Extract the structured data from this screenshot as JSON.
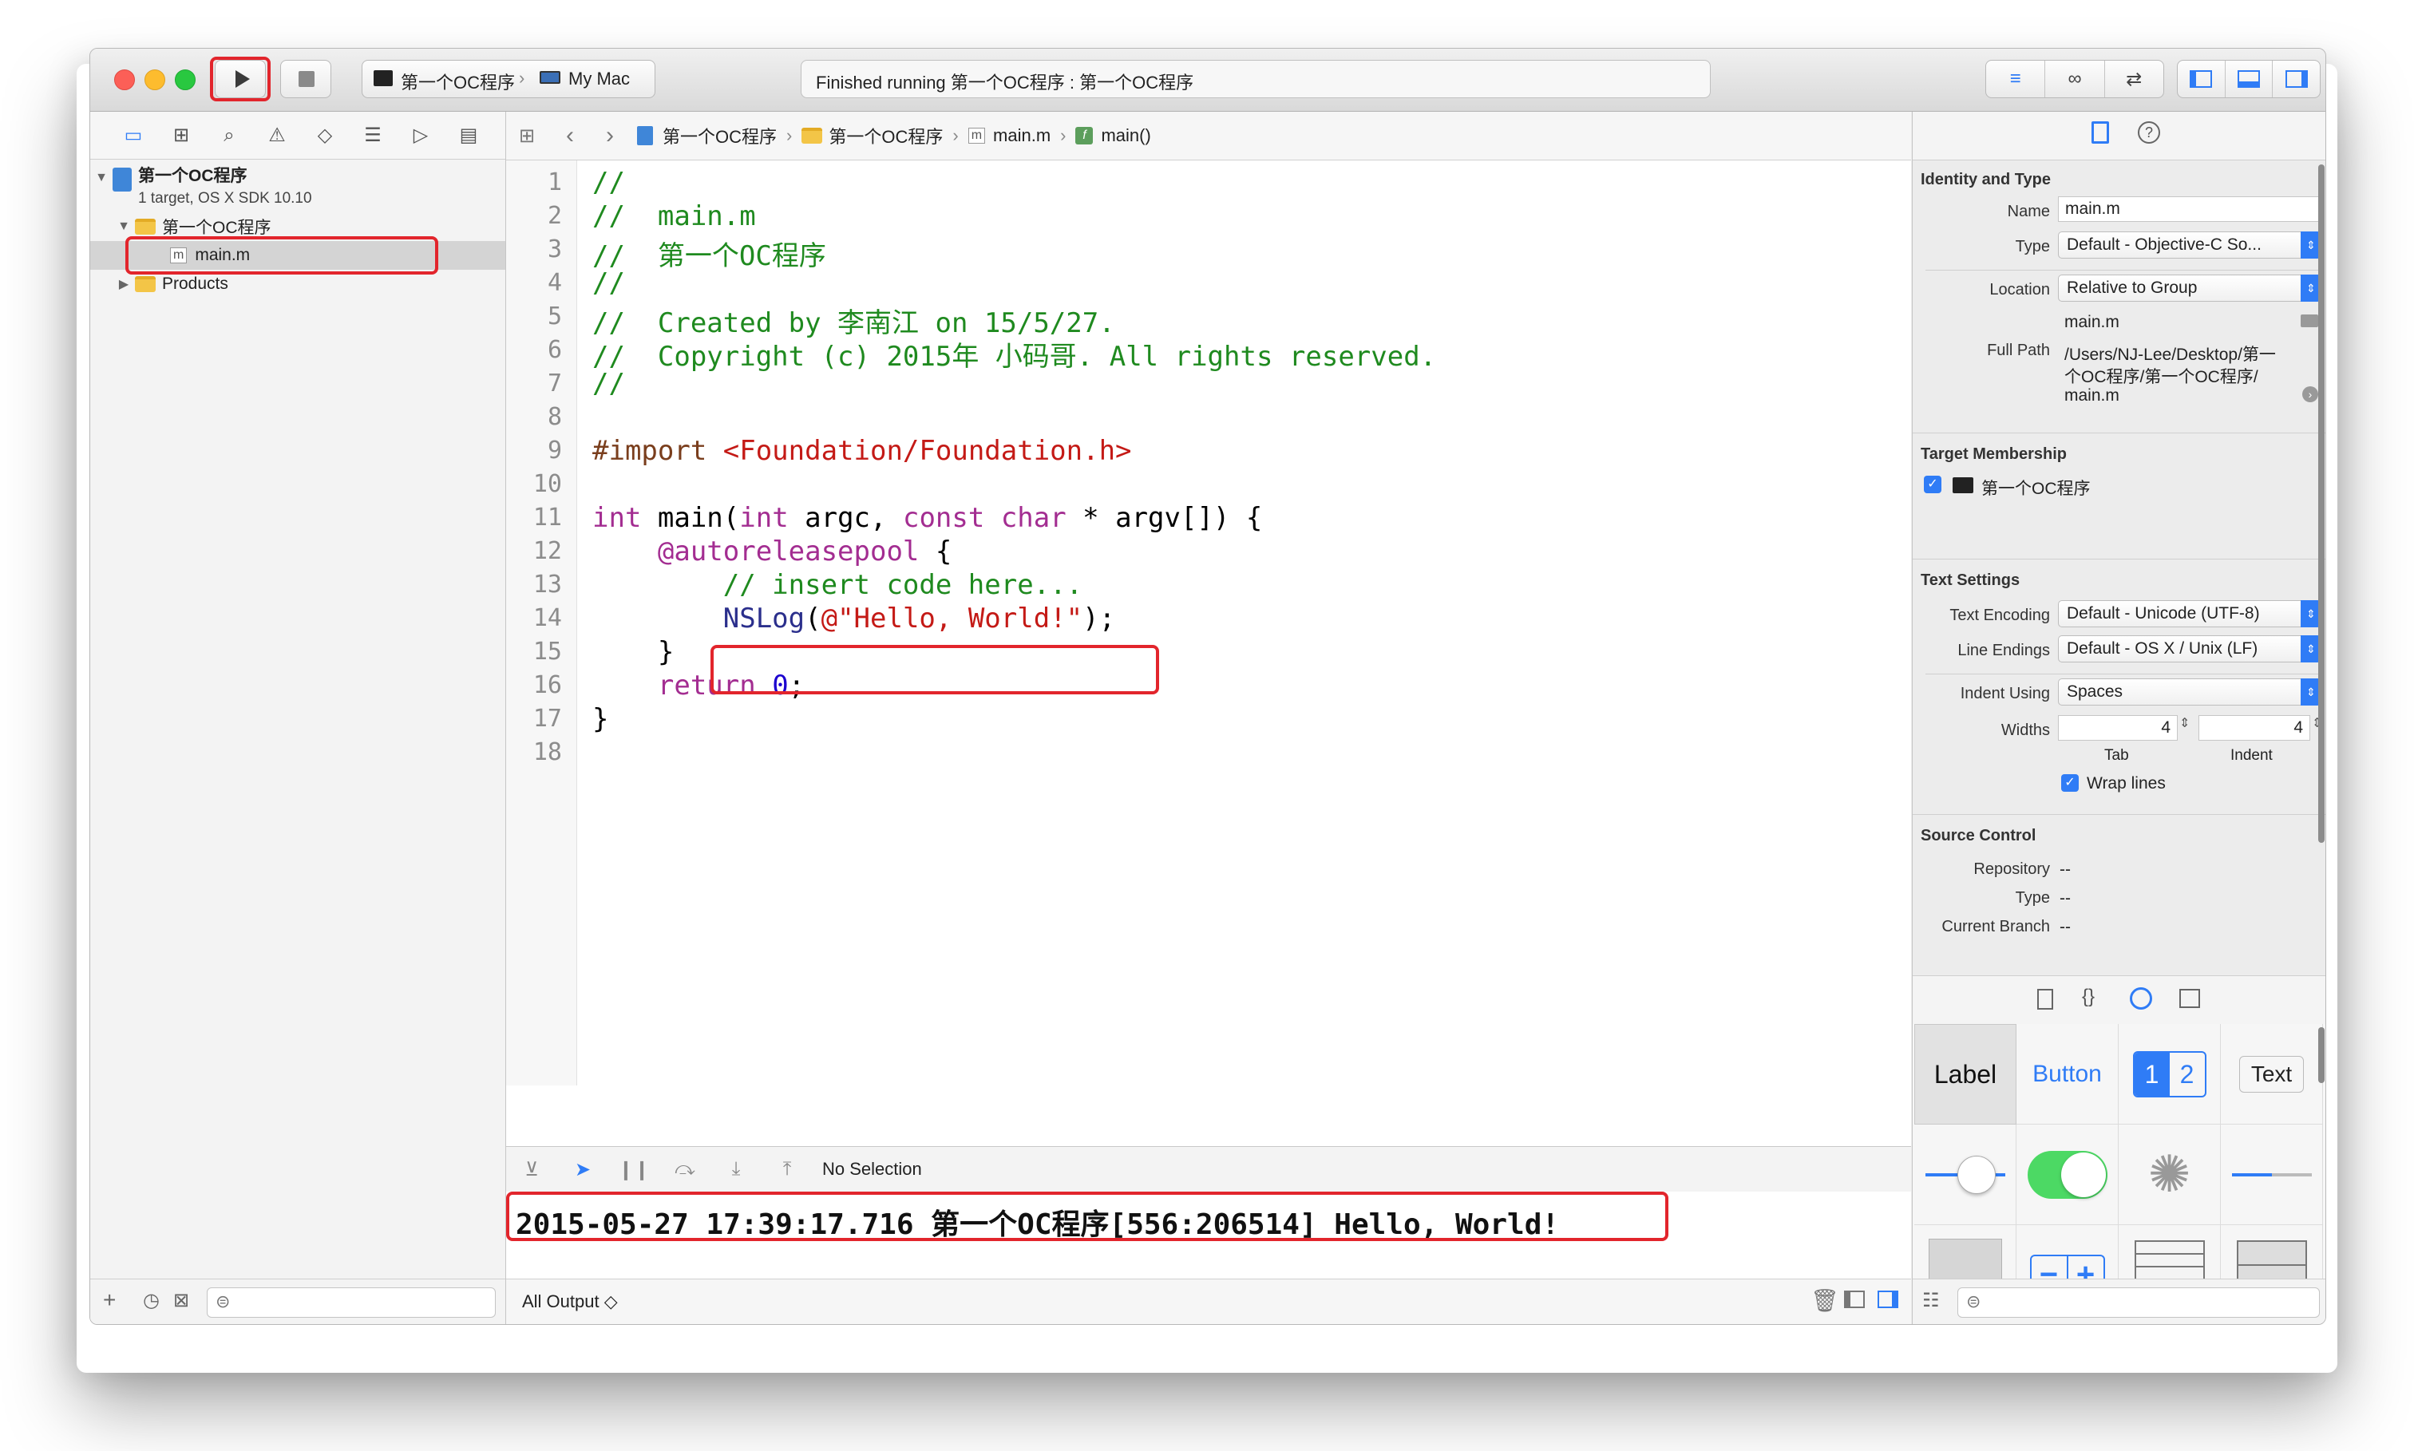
{
  "toolbar": {
    "scheme_target": "第一个OC程序",
    "scheme_device": "My Mac",
    "status": "Finished running 第一个OC程序 : 第一个OC程序"
  },
  "navigator": {
    "project_name": "第一个OC程序",
    "project_subtitle": "1 target, OS X SDK 10.10",
    "group_name": "第一个OC程序",
    "file_name": "main.m",
    "products": "Products"
  },
  "jumpbar": {
    "project": "第一个OC程序",
    "group": "第一个OC程序",
    "file": "main.m",
    "symbol": "main()"
  },
  "code": {
    "line_numbers": [
      "1",
      "2",
      "3",
      "4",
      "5",
      "6",
      "7",
      "8",
      "9",
      "10",
      "11",
      "12",
      "13",
      "14",
      "15",
      "16",
      "17",
      "18"
    ],
    "l1": "//",
    "l2": "//  main.m",
    "l3": "//  第一个OC程序",
    "l4": "//",
    "l5": "//  Created by 李南江 on 15/5/27.",
    "l6": "//  Copyright (c) 2015年 小码哥. All rights reserved.",
    "l7": "//",
    "l9_kw": "#import",
    "l9_str": " <Foundation/Foundation.h>",
    "l11_a": "int",
    "l11_b": " main(",
    "l11_c": "int",
    "l11_d": " argc, ",
    "l11_e": "const",
    "l11_f": " ",
    "l11_g": "char",
    "l11_h": " * argv[]) {",
    "l12_kw": "    @autoreleasepool",
    "l12_rest": " {",
    "l13": "        // insert code here...",
    "l14_fn": "        NSLog",
    "l14_p": "(",
    "l14_str": "@\"Hello, World!\"",
    "l14_end": ");",
    "l15": "    }",
    "l16_kw": "    return",
    "l16_sp": " ",
    "l16_num": "0",
    "l16_end": ";",
    "l17": "}"
  },
  "debug": {
    "selection": "No Selection",
    "console_output": "2015-05-27 17:39:17.716 第一个OC程序[556:206514] Hello, World!",
    "output_filter": "All Output ◇"
  },
  "inspector": {
    "identity_title": "Identity and Type",
    "name_label": "Name",
    "name_value": "main.m",
    "type_label": "Type",
    "type_value": "Default - Objective-C So...",
    "location_label": "Location",
    "location_value": "Relative to Group",
    "location_file": "main.m",
    "fullpath_label": "Full Path",
    "fullpath_value_1": "/Users/NJ-Lee/Desktop/第一",
    "fullpath_value_2": "个OC程序/第一个OC程序/",
    "fullpath_value_3": "main.m",
    "target_title": "Target Membership",
    "target_name": "第一个OC程序",
    "text_title": "Text Settings",
    "encoding_label": "Text Encoding",
    "encoding_value": "Default - Unicode (UTF-8)",
    "endings_label": "Line Endings",
    "endings_value": "Default - OS X / Unix (LF)",
    "indent_label": "Indent Using",
    "indent_value": "Spaces",
    "widths_label": "Widths",
    "tab_width": "4",
    "indent_width": "4",
    "tab_label": "Tab",
    "indent_sub_label": "Indent",
    "wrap_label": "Wrap lines",
    "source_title": "Source Control",
    "repo_label": "Repository",
    "repo_value": "--",
    "sc_type_label": "Type",
    "sc_type_value": "--",
    "branch_label": "Current Branch",
    "branch_value": "--"
  },
  "library": {
    "label": "Label",
    "button": "Button",
    "seg1": "1",
    "seg2": "2",
    "text": "Text"
  },
  "colors": {
    "highlight_red": "#e2252c",
    "accent_blue": "#2f7cf6",
    "comment_green": "#1f8a1f",
    "keyword_purple": "#a32d91",
    "string_red": "#c41a16"
  }
}
